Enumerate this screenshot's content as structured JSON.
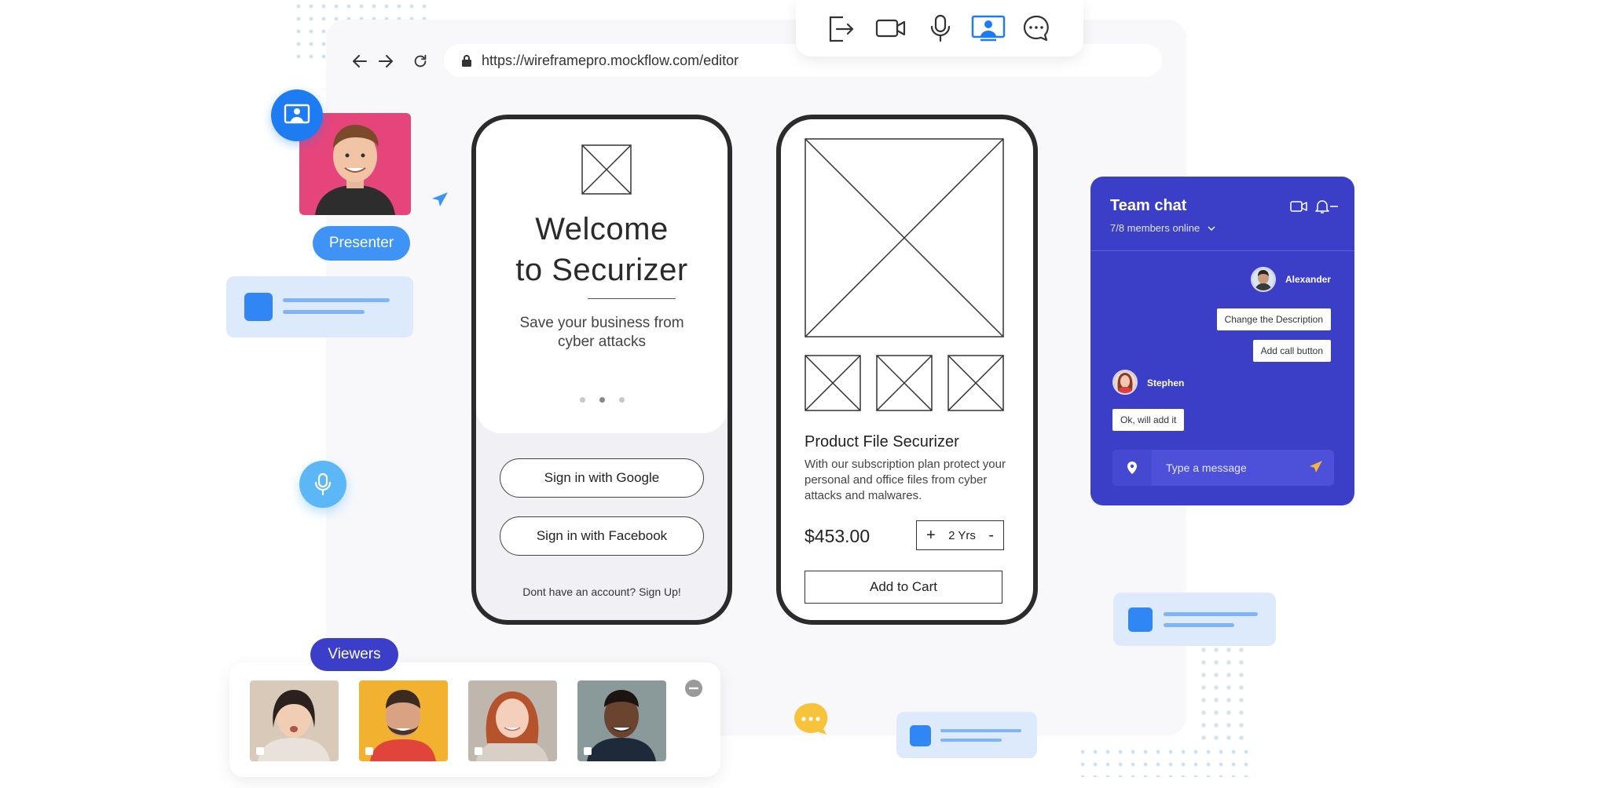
{
  "browser": {
    "url": "https://wireframepro.mockflow.com/editor"
  },
  "toolbar": {
    "icons": [
      "exit-icon",
      "video-camera-icon",
      "microphone-icon",
      "screen-share-icon",
      "chat-icon"
    ],
    "accent": "#1e7cf2"
  },
  "phone1": {
    "welcome_line1": "Welcome",
    "welcome_line2": "to Securizer",
    "subtitle_line1": "Save your business from",
    "subtitle_line2": "cyber attacks",
    "google_button": "Sign in with Google",
    "facebook_button": "Sign in with Facebook",
    "signup_text": "Dont have an account? Sign Up!"
  },
  "phone2": {
    "product_title": "Product File Securizer",
    "description": "With our subscription plan protect your personal and office files from cyber attacks and malwares.",
    "price": "$453.00",
    "quantity_plus": "+",
    "quantity_value": "2 Yrs",
    "quantity_minus": "-",
    "add_to_cart": "Add to Cart"
  },
  "presenter": {
    "label": "Presenter"
  },
  "viewers": {
    "label": "Viewers",
    "count": 4
  },
  "chat": {
    "title": "Team chat",
    "members": "7/8 members online",
    "messages": [
      {
        "sender": "Alexander",
        "texts": [
          "Change the Description",
          "Add call button"
        ]
      },
      {
        "sender": "Stephen",
        "texts": [
          "Ok, will add it"
        ]
      }
    ],
    "input_placeholder": "Type a message",
    "bg_color": "#3b3ec7"
  },
  "colors": {
    "presenter_pill": "#3f93f5",
    "viewers_pill": "#3a3ec9",
    "card_bg": "#ddeafc",
    "card_accent": "#2f86f4",
    "speech_bubble": "#f6c33a"
  }
}
